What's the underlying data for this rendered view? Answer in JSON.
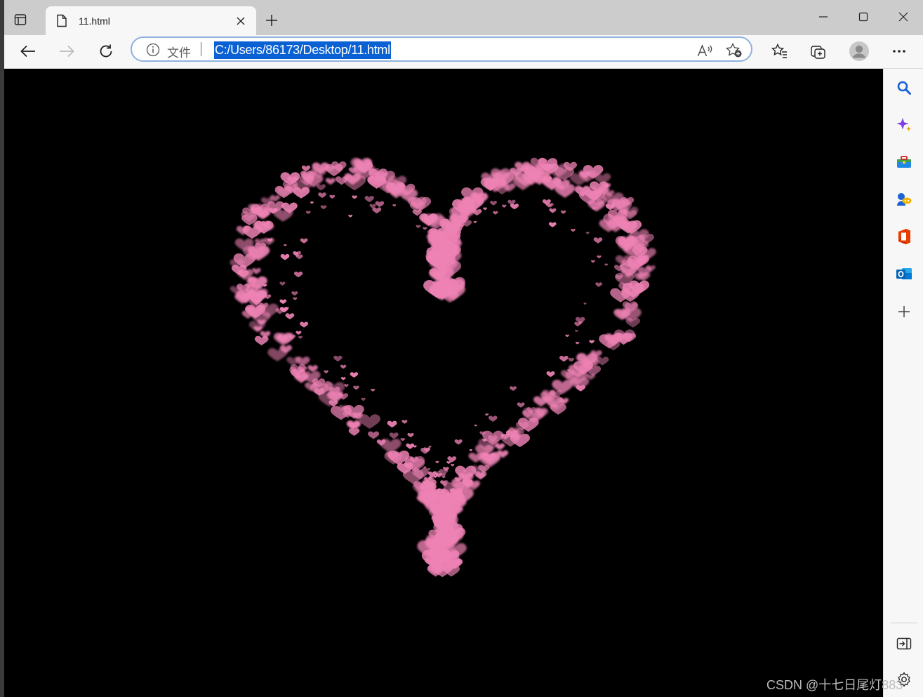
{
  "browser": {
    "tab": {
      "title": "11.html"
    },
    "address": {
      "scheme_label": "文件",
      "url": "C:/Users/86173/Desktop/11.html"
    }
  },
  "page": {
    "background": "#000000",
    "heart_color": "#ee82b4",
    "particle_shape": "heart"
  },
  "sidebar_icons": [
    "search-icon",
    "copilot-icon",
    "tools-icon",
    "games-icon",
    "office-icon",
    "outlook-icon",
    "add-icon",
    "hide-sidebar-icon",
    "settings-icon"
  ],
  "watermark": {
    "text": "CSDN @十七日尾灯883"
  }
}
